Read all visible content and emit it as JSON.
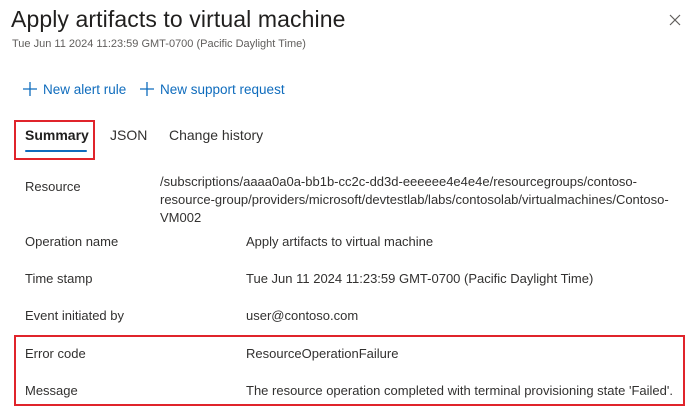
{
  "header": {
    "title": "Apply artifacts to virtual machine",
    "subtitle": "Tue Jun 11 2024 11:23:59 GMT-0700 (Pacific Daylight Time)"
  },
  "commands": {
    "new_alert_rule": "New alert rule",
    "new_support_request": "New support request"
  },
  "tabs": {
    "summary": "Summary",
    "json": "JSON",
    "change_history": "Change history",
    "selected": "Summary"
  },
  "details": {
    "resource_label": "Resource",
    "resource_value_lines": [
      "/subscriptions/aaaa0a0a-bb1b-cc2c-dd3d-eeeeee4e4e4e/resourcegroups/contoso-",
      "resource-group/providers/microsoft/devtestlab/labs/contosolab/virtualmachines/Contoso-",
      "VM002"
    ],
    "operation_name_label": "Operation name",
    "operation_name_value": "Apply artifacts to virtual machine",
    "time_stamp_label": "Time stamp",
    "time_stamp_value": "Tue Jun 11 2024 11:23:59 GMT-0700 (Pacific Daylight Time)",
    "event_initiated_by_label": "Event initiated by",
    "event_initiated_by_value": "user@contoso.com",
    "error_code_label": "Error code",
    "error_code_value": "ResourceOperationFailure",
    "message_label": "Message",
    "message_value": "The resource operation completed with terminal provisioning state 'Failed'."
  },
  "colors": {
    "accent": "#0f6cbd",
    "highlight_box": "#e0242b",
    "text": "#323130",
    "secondary_text": "#605e5c"
  },
  "icons": {
    "close": "close-icon",
    "add": "plus-icon"
  }
}
